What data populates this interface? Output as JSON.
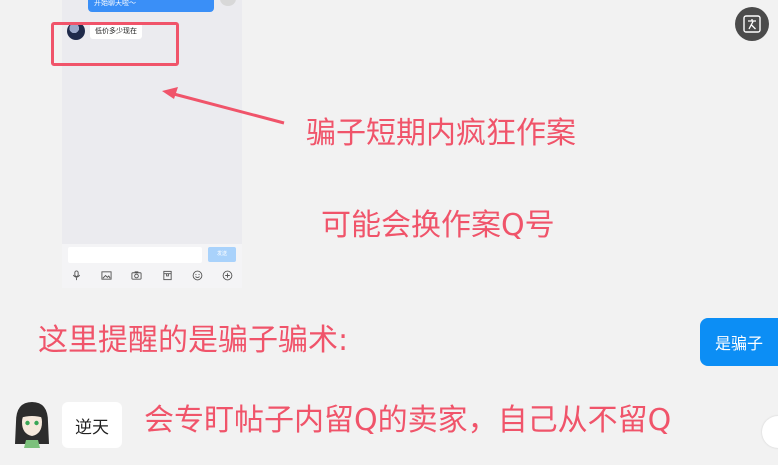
{
  "chat": {
    "sent_message": "开始聊天啦～",
    "received_message": "低价多少现在",
    "input_placeholder": "",
    "send_label": "发送",
    "toolbar_icons": [
      "microphone-icon",
      "image-icon",
      "camera-icon",
      "package-icon",
      "emoji-icon",
      "plus-icon"
    ]
  },
  "annotations": {
    "line1": "骗子短期内疯狂作案",
    "line2": "可能会换作案Q号",
    "line3": "这里提醒的是骗子骗术:",
    "line4": "会专盯帖子内留Q的卖家，自己从不留Q"
  },
  "controls": {
    "scam_button": "是骗子",
    "translate_icon": "translate-icon"
  },
  "user": {
    "name": "逆天"
  },
  "colors": {
    "accent": "#f0546a",
    "button_blue": "#0c8ef5",
    "bubble_blue": "#3a8ff7"
  }
}
